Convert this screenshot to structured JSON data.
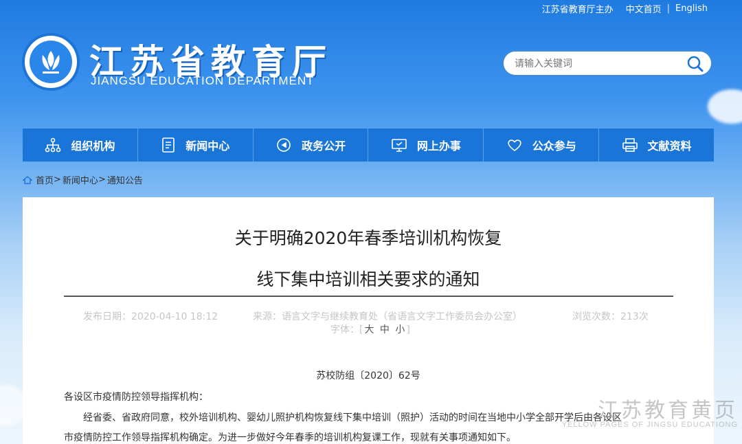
{
  "top_links": {
    "sponsor": "江苏省教育厅主办",
    "chinese": "中文首页",
    "sep": "|",
    "english": "English"
  },
  "logo": {
    "title": "江苏省教育厅",
    "subtitle": "JIANGSU EDUCATION DEPARTMENT"
  },
  "search": {
    "placeholder": "请输入关键词"
  },
  "nav": {
    "items": [
      {
        "label": "组织机构",
        "icon": "org-chart-icon"
      },
      {
        "label": "新闻中心",
        "icon": "document-icon"
      },
      {
        "label": "政务公开",
        "icon": "compass-icon"
      },
      {
        "label": "网上办事",
        "icon": "monitor-icon"
      },
      {
        "label": "公众参与",
        "icon": "heart-icon"
      },
      {
        "label": "文献资料",
        "icon": "printer-icon"
      }
    ]
  },
  "breadcrumb": {
    "home": "首页",
    "sep1": ">",
    "news": "新闻中心",
    "sep2": ">",
    "current": "通知公告"
  },
  "article": {
    "title_line1": "关于明确2020年春季培训机构恢复",
    "title_line2": "线下集中培训相关要求的通知",
    "publish_date": "发布日期：2020-04-10 18:12",
    "source": "来源：语言文字与继续教育处（省语言文字工作委员会办公室）",
    "views": "浏览次数：213次",
    "font_label": "字体：",
    "font_big": "大",
    "font_mid": "中",
    "font_small": "小",
    "doc_number": "苏校防组〔2020〕62号",
    "addressee": "各设区市疫情防控领导指挥机构：",
    "para1": "经省委、省政府同意，校外培训机构、婴幼儿照护机构恢复线下集中培训（照护）活动的时间在当地中小学全部开学后由各设区",
    "para2": "市疫情防控工作领导指挥机构确定。为进一步做好今年春季的培训机构复课工作，现就有关事项通知如下。"
  },
  "watermark": {
    "cn": "江苏教育黄页",
    "en": "YELLOW PAGES OF JINGSU EDUCATIONG"
  },
  "colors": {
    "nav": "#1a75d8",
    "accent": "#1b74d6"
  }
}
